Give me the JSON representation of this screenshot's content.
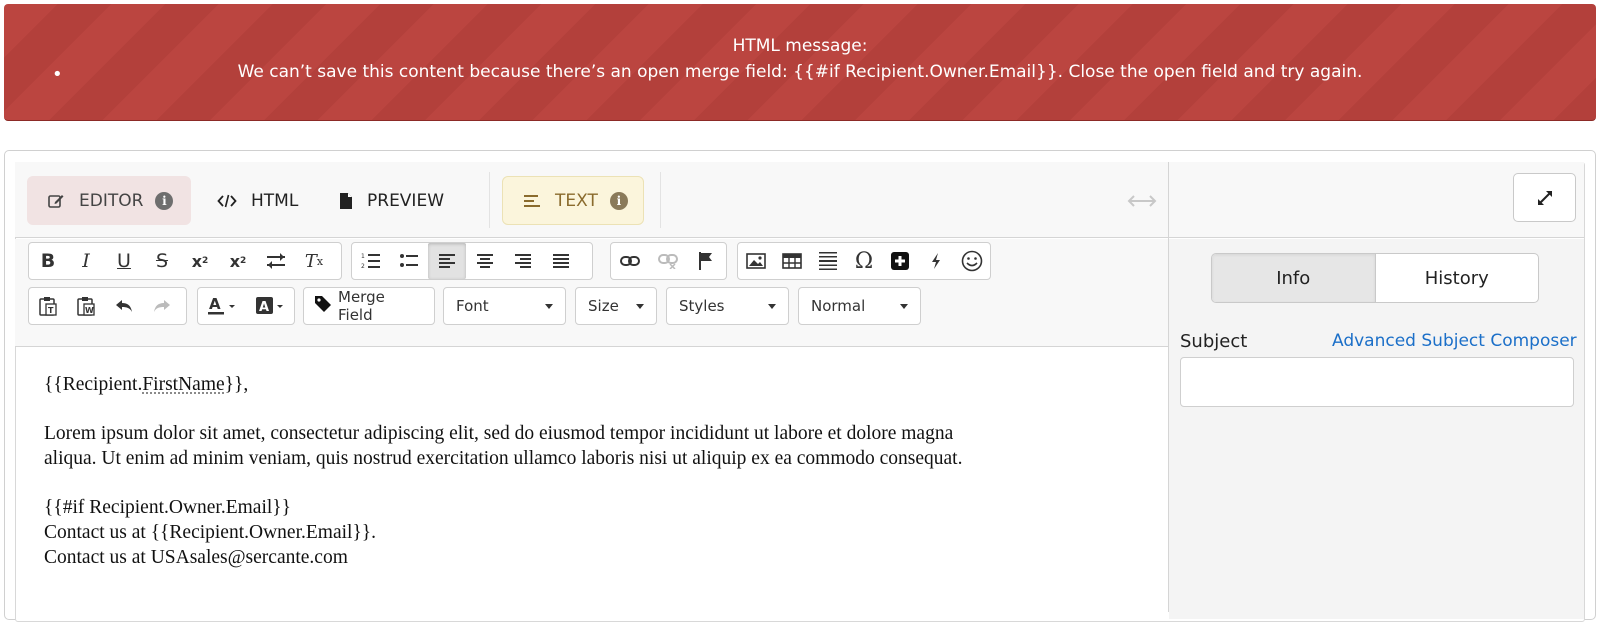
{
  "banner": {
    "title": "HTML message:",
    "bullet": "•",
    "message": "We can’t save this content because there’s an open merge field: {{#if Recipient.Owner.Email}}. Close the open field and try again."
  },
  "tabs": {
    "editor": "EDITOR",
    "html": "HTML",
    "preview": "PREVIEW",
    "text": "TEXT",
    "info_glyph": "i"
  },
  "toolbar": {
    "merge_field": "Merge Field",
    "font": "Font",
    "size": "Size",
    "styles": "Styles",
    "format": "Normal"
  },
  "right_panel": {
    "info_tab": "Info",
    "history_tab": "History",
    "subject_label": "Subject",
    "advanced_link": "Advanced Subject Composer",
    "subject_value": ""
  },
  "content": {
    "greeting_prefix": "{{Recipient.",
    "greeting_field": "FirstName",
    "greeting_suffix": "}},",
    "paragraph_line1": "Lorem ipsum dolor sit amet, consectetur adipiscing elit, sed do eiusmod tempor incididunt ut labore et dolore magna",
    "paragraph_line2": "aliqua. Ut enim ad minim veniam, quis nostrud exercitation ullamco laboris nisi ut aliquip ex ea commodo consequat.",
    "if_line": "{{#if Recipient.Owner.Email}}",
    "contact_line1": "Contact us at {{Recipient.Owner.Email}}.",
    "contact_line2": "Contact us at USAsales@sercante.com"
  },
  "colors": {
    "banner_bg": "#bb4540",
    "link": "#1b6fc8",
    "editor_tab_bg": "#f1e3e3",
    "text_tab_bg": "#fbf5dc"
  }
}
